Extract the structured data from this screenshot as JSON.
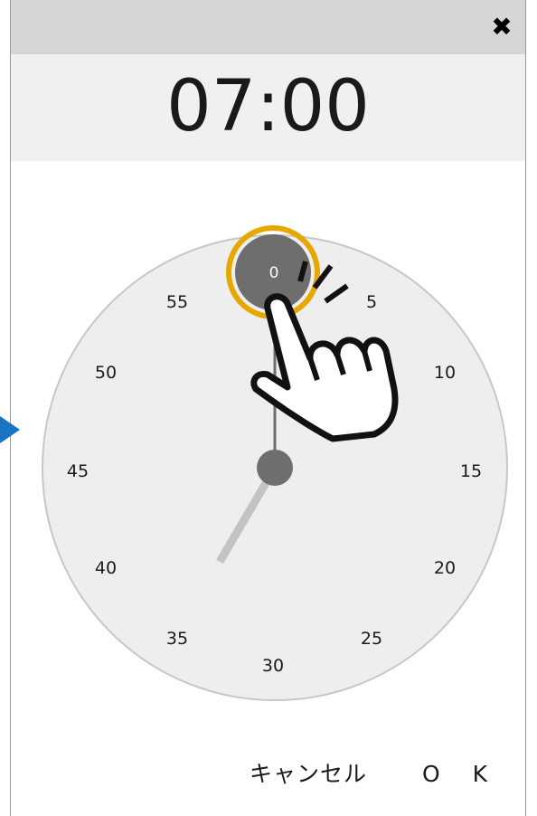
{
  "dialog": {
    "close_icon": "close-icon",
    "time_display": "07:00",
    "cancel_label": "キャンセル",
    "ok_label": "OK"
  },
  "clock": {
    "selected_minute": "0",
    "minute_labels": [
      "0",
      "5",
      "10",
      "15",
      "20",
      "25",
      "30",
      "35",
      "40",
      "45",
      "50",
      "55"
    ],
    "hour_value": 7,
    "minute_value": 0,
    "colors": {
      "face": "#eeeeee",
      "face_border": "#c7c7c7",
      "selector": "#6e6e6e",
      "highlight_ring": "#e6a800",
      "hour_hand": "#c3c3c3"
    }
  },
  "overlay": {
    "pointer_icon": "hand-pointer-icon",
    "arrow_icon": "arrow-right-icon",
    "arrow_color": "#1a74c4"
  }
}
